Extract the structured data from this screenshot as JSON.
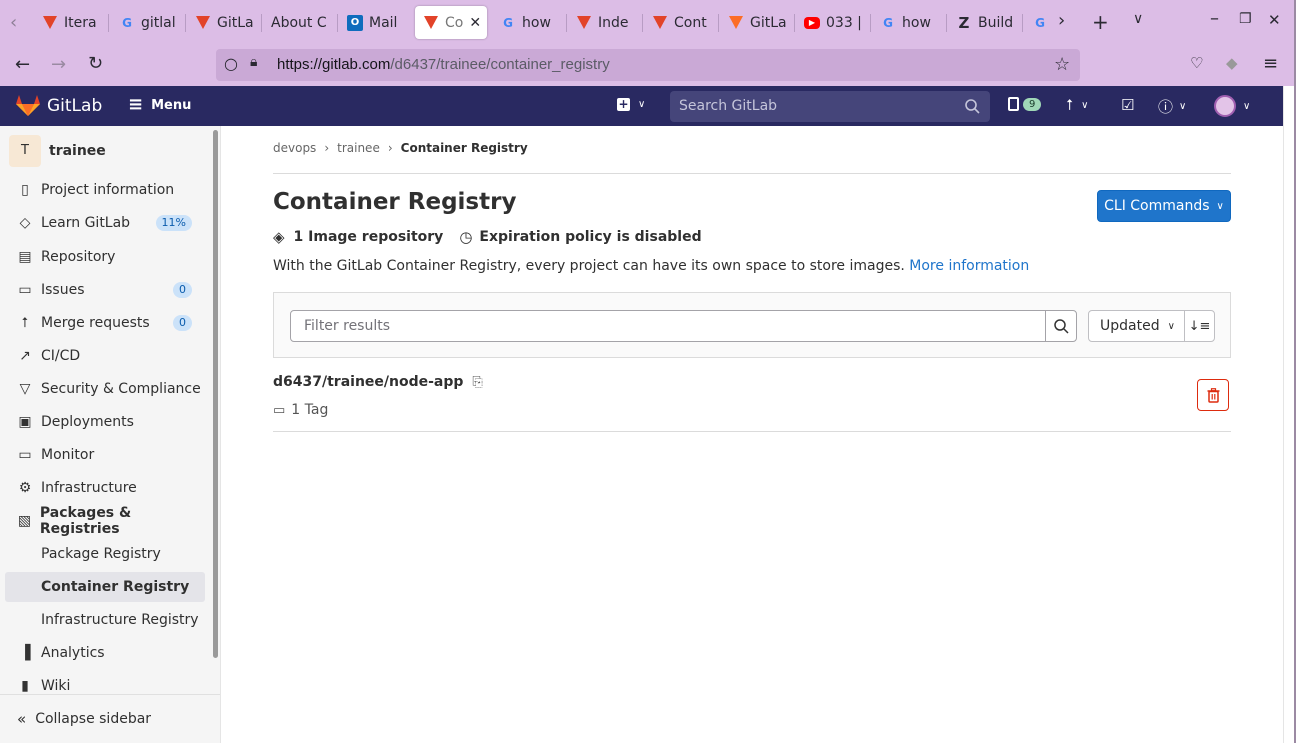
{
  "browser": {
    "tabs": [
      {
        "label": "Itera",
        "icon": "gitlab-icon"
      },
      {
        "label": "gitlal",
        "icon": "google-icon"
      },
      {
        "label": "GitLa",
        "icon": "gitlab-icon"
      },
      {
        "label": "About C",
        "icon": ""
      },
      {
        "label": "Mail",
        "icon": "outlook-icon"
      },
      {
        "label": "Co",
        "icon": "gitlab-icon",
        "active": true
      },
      {
        "label": "how",
        "icon": "google-icon"
      },
      {
        "label": "Inde",
        "icon": "gitlab-icon"
      },
      {
        "label": "Cont",
        "icon": "gitlab-icon"
      },
      {
        "label": "GitLa",
        "icon": "gitlab-orange-icon"
      },
      {
        "label": "033 |",
        "icon": "youtube-icon"
      },
      {
        "label": "how",
        "icon": "google-icon"
      },
      {
        "label": "Build",
        "icon": "z-icon"
      },
      {
        "label": "G",
        "icon": "google-icon"
      }
    ],
    "url_prefix": "https://gitlab.com",
    "url_path": "/d6437/trainee/container_registry"
  },
  "header": {
    "brand": "GitLab",
    "menu_label": "Menu",
    "search_placeholder": "Search GitLab",
    "issues_count": "9"
  },
  "sidebar": {
    "project_initial": "T",
    "project_name": "trainee",
    "items": [
      {
        "label": "Project information",
        "icon": "info-document-icon"
      },
      {
        "label": "Learn GitLab",
        "icon": "graduation-cap-icon",
        "badge": "11%"
      },
      {
        "label": "Repository",
        "icon": "repository-icon"
      },
      {
        "label": "Issues",
        "icon": "issues-icon",
        "badge": "0"
      },
      {
        "label": "Merge requests",
        "icon": "merge-request-icon",
        "badge": "0"
      },
      {
        "label": "CI/CD",
        "icon": "rocket-icon"
      },
      {
        "label": "Security & Compliance",
        "icon": "shield-icon"
      },
      {
        "label": "Deployments",
        "icon": "deployments-icon"
      },
      {
        "label": "Monitor",
        "icon": "monitor-icon"
      },
      {
        "label": "Infrastructure",
        "icon": "cloud-gear-icon"
      },
      {
        "label": "Packages & Registries",
        "icon": "package-icon"
      },
      {
        "label": "Package Registry"
      },
      {
        "label": "Container Registry"
      },
      {
        "label": "Infrastructure Registry"
      },
      {
        "label": "Analytics",
        "icon": "chart-icon"
      },
      {
        "label": "Wiki",
        "icon": "book-icon"
      }
    ],
    "collapse_label": "Collapse sidebar"
  },
  "breadcrumb": [
    "devops",
    "trainee",
    "Container Registry"
  ],
  "main": {
    "title": "Container Registry",
    "cli_button": "CLI Commands",
    "image_count": "1 Image repository",
    "expiration": "Expiration policy is disabled",
    "description": "With the GitLab Container Registry, every project can have its own space to store images.",
    "more_info": "More information",
    "filter_placeholder": "Filter results",
    "sort_label": "Updated",
    "repo_name": "d6437/trainee/node-app",
    "tag_count": "1 Tag"
  },
  "colors": {
    "header_bg": "#292961",
    "primary": "#1f75cb",
    "danger": "#dd2b0e",
    "browser_chrome": "#dcbde6"
  }
}
